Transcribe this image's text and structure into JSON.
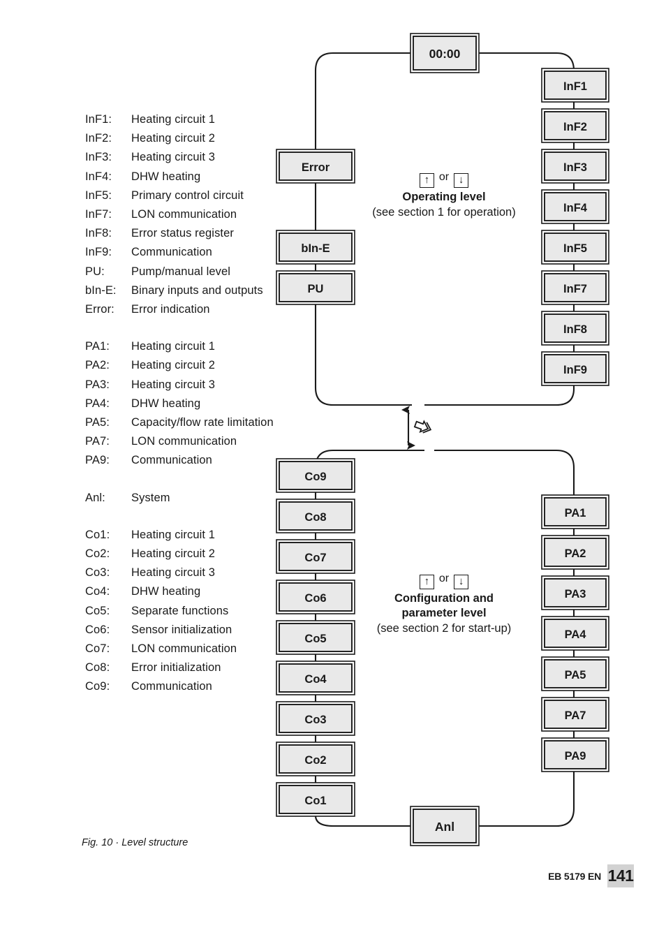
{
  "figure": {
    "caption": "Fig. 10 · Level structure"
  },
  "footer": {
    "doc_id": "EB 5179 EN",
    "page_number": "141"
  },
  "legend": {
    "groups": [
      {
        "rows": [
          {
            "key": "InF1:",
            "value": "Heating circuit 1"
          },
          {
            "key": "InF2:",
            "value": "Heating circuit 2"
          },
          {
            "key": "InF3:",
            "value": "Heating circuit 3"
          },
          {
            "key": "InF4:",
            "value": "DHW heating"
          },
          {
            "key": "InF5:",
            "value": "Primary control circuit"
          },
          {
            "key": "InF7:",
            "value": "LON communication"
          },
          {
            "key": "InF8:",
            "value": "Error status register"
          },
          {
            "key": "InF9:",
            "value": "Communication"
          },
          {
            "key": "PU:",
            "value": "Pump/manual level"
          },
          {
            "key": "bIn-E:",
            "value": "Binary inputs and outputs"
          },
          {
            "key": "Error:",
            "value": "Error indication"
          }
        ]
      },
      {
        "rows": [
          {
            "key": "PA1:",
            "value": "Heating circuit 1"
          },
          {
            "key": "PA2:",
            "value": "Heating circuit 2"
          },
          {
            "key": "PA3:",
            "value": "Heating circuit 3"
          },
          {
            "key": "PA4:",
            "value": "DHW heating"
          },
          {
            "key": "PA5:",
            "value": "Capacity/flow rate limitation"
          },
          {
            "key": "PA7:",
            "value": "LON communication"
          },
          {
            "key": "PA9:",
            "value": "Communication"
          }
        ]
      },
      {
        "rows": [
          {
            "key": "Anl:",
            "value": "System"
          }
        ]
      },
      {
        "rows": [
          {
            "key": "Co1:",
            "value": "Heating circuit 1"
          },
          {
            "key": "Co2:",
            "value": "Heating circuit 2"
          },
          {
            "key": "Co3:",
            "value": "Heating circuit 3"
          },
          {
            "key": "Co4:",
            "value": "DHW heating"
          },
          {
            "key": "Co5:",
            "value": "Separate functions"
          },
          {
            "key": "Co6:",
            "value": "Sensor initialization"
          },
          {
            "key": "Co7:",
            "value": "LON communication"
          },
          {
            "key": "Co8:",
            "value": "Error initialization"
          },
          {
            "key": "Co9:",
            "value": "Communication"
          }
        ]
      }
    ]
  },
  "diagram": {
    "clock_box": {
      "label": "00:00"
    },
    "anl_box": {
      "label": "Anl"
    },
    "operating_level": {
      "key_up": "↑",
      "key_down": "↓",
      "or": "or",
      "title": "Operating level",
      "subtitle": "(see section 1 for operation)",
      "left_boxes": [
        {
          "label": "Error"
        },
        {
          "label": "bIn-E"
        },
        {
          "label": "PU"
        }
      ],
      "right_boxes": [
        {
          "label": "InF1"
        },
        {
          "label": "InF2"
        },
        {
          "label": "InF3"
        },
        {
          "label": "InF4"
        },
        {
          "label": "InF5"
        },
        {
          "label": "InF7"
        },
        {
          "label": "InF8"
        },
        {
          "label": "InF9"
        }
      ]
    },
    "config_level": {
      "key_up": "↑",
      "key_down": "↓",
      "or": "or",
      "title_line1": "Configuration and",
      "title_line2": "parameter level",
      "subtitle": "(see section 2 for start-up)",
      "left_boxes": [
        {
          "label": "Co9"
        },
        {
          "label": "Co8"
        },
        {
          "label": "Co7"
        },
        {
          "label": "Co6"
        },
        {
          "label": "Co5"
        },
        {
          "label": "Co4"
        },
        {
          "label": "Co3"
        },
        {
          "label": "Co2"
        },
        {
          "label": "Co1"
        }
      ],
      "right_boxes": [
        {
          "label": "PA1"
        },
        {
          "label": "PA2"
        },
        {
          "label": "PA3"
        },
        {
          "label": "PA4"
        },
        {
          "label": "PA5"
        },
        {
          "label": "PA7"
        },
        {
          "label": "PA9"
        }
      ]
    },
    "level_switch": {
      "icon": "double-chevron-key-icon"
    },
    "colors": {
      "box_fill": "#e9e9e9",
      "line": "#1a1a1a",
      "page_badge": "#d2d2d2"
    }
  }
}
